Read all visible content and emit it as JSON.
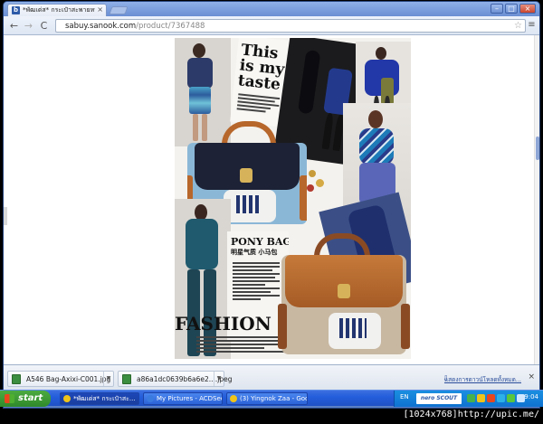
{
  "browser": {
    "tab_title": "*พัฒเด่ส* กระเป๋าสะพายหนัง",
    "tab_favicon": "b",
    "tab_close": "×",
    "url_host": "sabuy.sanook.com",
    "url_path": "/product/7367488",
    "back": "←",
    "forward": "→",
    "reload": "C",
    "star": "☆",
    "menu": "≡",
    "win_min": "–",
    "win_max": "□",
    "win_close": "×"
  },
  "collage": {
    "headline_1": "This",
    "headline_2": "is my",
    "headline_3": "taste",
    "pony_title": "PONY BAG",
    "pony_subtitle": "明星气质 小马包",
    "fashion_text": "FASHION PI"
  },
  "downloads": {
    "items": [
      {
        "name": "A546 Bag-Axixi-C001.jpg"
      },
      {
        "name": "a86a1dc0639b6a6e2....jpeg"
      }
    ],
    "show_all": "แสดงการดาวน์โหลดทั้งหมด...",
    "close": "×"
  },
  "taskbar": {
    "start": "start",
    "tasks": [
      {
        "label": "*พัฒเด่ส* กระเป๋าสะ..."
      },
      {
        "label": "My Pictures - ACDSee..."
      },
      {
        "label": "(3) Yingnok Zaa - Goo..."
      }
    ],
    "lang": "EN",
    "nero": "nero SCOUT",
    "clock": "9:04"
  },
  "watermark": "[1024x768]http://upic.me/"
}
